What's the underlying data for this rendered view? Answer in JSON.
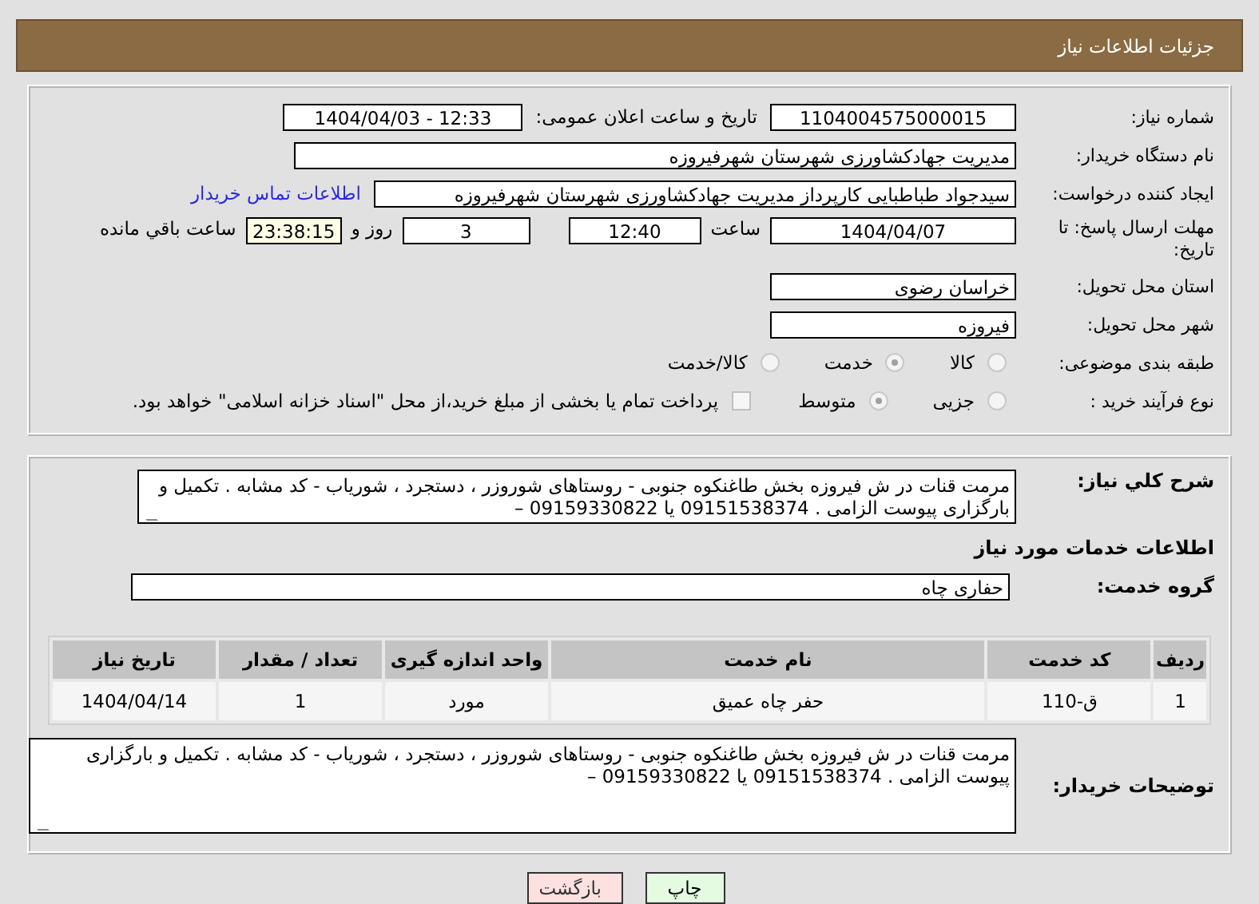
{
  "header": {
    "title": "جزئیات اطلاعات نیاز"
  },
  "need_number": {
    "label": "شماره نیاز:",
    "value": "1104004575000015"
  },
  "announce": {
    "label": "تاریخ و ساعت اعلان عمومی:",
    "value": "1404/04/03 - 12:33"
  },
  "buyer_org": {
    "label": "نام دستگاه خریدار:",
    "value": "مدیریت جهادکشاورزی شهرستان شهرفیروزه"
  },
  "creator": {
    "label": "ایجاد کننده درخواست:",
    "value": "سیدجواد طباطبایی کارپرداز مدیریت جهادکشاورزی شهرستان شهرفیروزه",
    "link": "اطلاعات تماس خریدار"
  },
  "deadline": {
    "label": "مهلت ارسال پاسخ: تا تاریخ:",
    "date": "1404/04/07",
    "time_label": "ساعت",
    "time": "12:40",
    "days": "3",
    "days_label": "روز و",
    "remaining": "23:38:15",
    "remaining_label": "ساعت باقي مانده"
  },
  "province": {
    "label": "استان محل تحویل:",
    "value": "خراسان رضوی"
  },
  "city": {
    "label": "شهر محل تحویل:",
    "value": "فیروزه"
  },
  "category": {
    "label": "طبقه بندی موضوعی:",
    "options": [
      {
        "label": "کالا",
        "selected": false
      },
      {
        "label": "خدمت",
        "selected": true
      },
      {
        "label": "کالا/خدمت",
        "selected": false
      }
    ]
  },
  "purchase_type": {
    "label": "نوع فرآیند خرید :",
    "options": [
      {
        "label": "جزیی",
        "selected": false
      },
      {
        "label": "متوسط",
        "selected": true
      }
    ],
    "treasury": {
      "label": "پرداخت تمام یا بخشی از مبلغ خرید،از محل \"اسناد خزانه اسلامی\" خواهد بود.",
      "checked": false
    }
  },
  "description": {
    "label": "شرح کلي نياز:",
    "value": "مرمت قنات در ش فیروزه بخش طاغنکوه جنوبی - روستاهای شوروزر ، دستجرد ، شورياب - کد مشابه . تکمیل و بارگزاری پیوست الزامی . 09151538374 یا 09159330822 –"
  },
  "services_heading": "اطلاعات خدمات مورد نیاز",
  "service_group": {
    "label": "گروه خدمت:",
    "value": "حفاری چاه"
  },
  "table": {
    "columns": [
      "ردیف",
      "کد خدمت",
      "نام خدمت",
      "واحد اندازه گیری",
      "تعداد / مقدار",
      "تاریخ نیاز"
    ],
    "rows": [
      [
        "1",
        "ق-110",
        "حفر چاه عمیق",
        "مورد",
        "1",
        "1404/04/14"
      ]
    ]
  },
  "buyer_notes": {
    "label": "توضیحات خریدار:",
    "value": "مرمت قنات در ش فیروزه بخش طاغنکوه جنوبی - روستاهای شوروزر ، دستجرد ، شورياب - کد مشابه . تکمیل و بارگزاری پیوست الزامی . 09151538374 یا 09159330822 –"
  },
  "buttons": [
    {
      "label": "چاپ",
      "kind": "print"
    },
    {
      "label": "بازگشت",
      "kind": "back"
    }
  ]
}
